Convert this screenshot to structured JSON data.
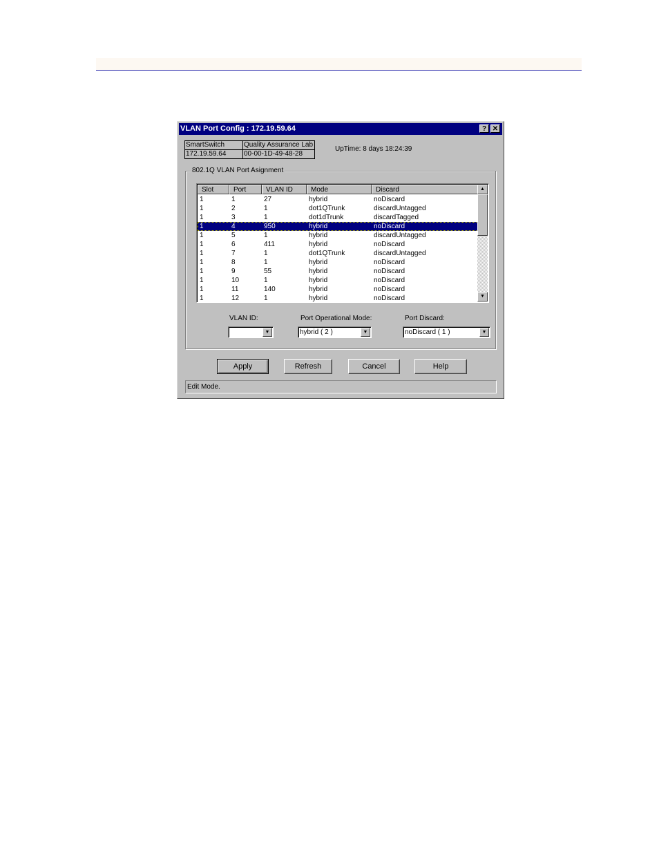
{
  "dialog": {
    "title": "VLAN Port Config : 172.19.59.64",
    "help_button": "?",
    "close_button": "✕",
    "info": {
      "device_name": "SmartSwitch",
      "location": "Quality Assurance Lab",
      "ip_address": "172.19.59.64",
      "mac_address": "00-00-1D-49-48-28"
    },
    "uptime": "UpTime: 8 days 18:24:39",
    "group_title": "802.1Q VLAN Port Asignment",
    "table": {
      "columns": [
        "Slot",
        "Port",
        "VLAN ID",
        "Mode",
        "Discard"
      ],
      "selected_index": 3,
      "rows": [
        {
          "slot": "1",
          "port": "1",
          "vlan_id": "27",
          "mode": "hybrid",
          "discard": "noDiscard"
        },
        {
          "slot": "1",
          "port": "2",
          "vlan_id": "1",
          "mode": "dot1QTrunk",
          "discard": "discardUntagged"
        },
        {
          "slot": "1",
          "port": "3",
          "vlan_id": "1",
          "mode": "dot1dTrunk",
          "discard": "discardTagged"
        },
        {
          "slot": "1",
          "port": "4",
          "vlan_id": "950",
          "mode": "hybrid",
          "discard": "noDiscard"
        },
        {
          "slot": "1",
          "port": "5",
          "vlan_id": "1",
          "mode": "hybrid",
          "discard": "discardUntagged"
        },
        {
          "slot": "1",
          "port": "6",
          "vlan_id": "411",
          "mode": "hybrid",
          "discard": "noDiscard"
        },
        {
          "slot": "1",
          "port": "7",
          "vlan_id": "1",
          "mode": "dot1QTrunk",
          "discard": "discardUntagged"
        },
        {
          "slot": "1",
          "port": "8",
          "vlan_id": "1",
          "mode": "hybrid",
          "discard": "noDiscard"
        },
        {
          "slot": "1",
          "port": "9",
          "vlan_id": "55",
          "mode": "hybrid",
          "discard": "noDiscard"
        },
        {
          "slot": "1",
          "port": "10",
          "vlan_id": "1",
          "mode": "hybrid",
          "discard": "noDiscard"
        },
        {
          "slot": "1",
          "port": "11",
          "vlan_id": "140",
          "mode": "hybrid",
          "discard": "noDiscard"
        },
        {
          "slot": "1",
          "port": "12",
          "vlan_id": "1",
          "mode": "hybrid",
          "discard": "noDiscard"
        }
      ]
    },
    "fields": {
      "vlan_id": {
        "label": "VLAN ID:",
        "value": ""
      },
      "port_mode": {
        "label": "Port Operational Mode:",
        "value": "hybrid ( 2 )"
      },
      "port_discard": {
        "label": "Port Discard:",
        "value": "noDiscard ( 1 )"
      }
    },
    "buttons": {
      "apply": "Apply",
      "refresh": "Refresh",
      "cancel": "Cancel",
      "help": "Help"
    },
    "status": "Edit Mode.",
    "icons": {
      "scroll_up": "▲",
      "scroll_down": "▼",
      "dropdown": "▼"
    }
  },
  "colors": {
    "titlebar": "#000080",
    "selection": "#000080",
    "dialog_bg": "#c0c0c0",
    "header_rule": "#1a1aa6"
  }
}
